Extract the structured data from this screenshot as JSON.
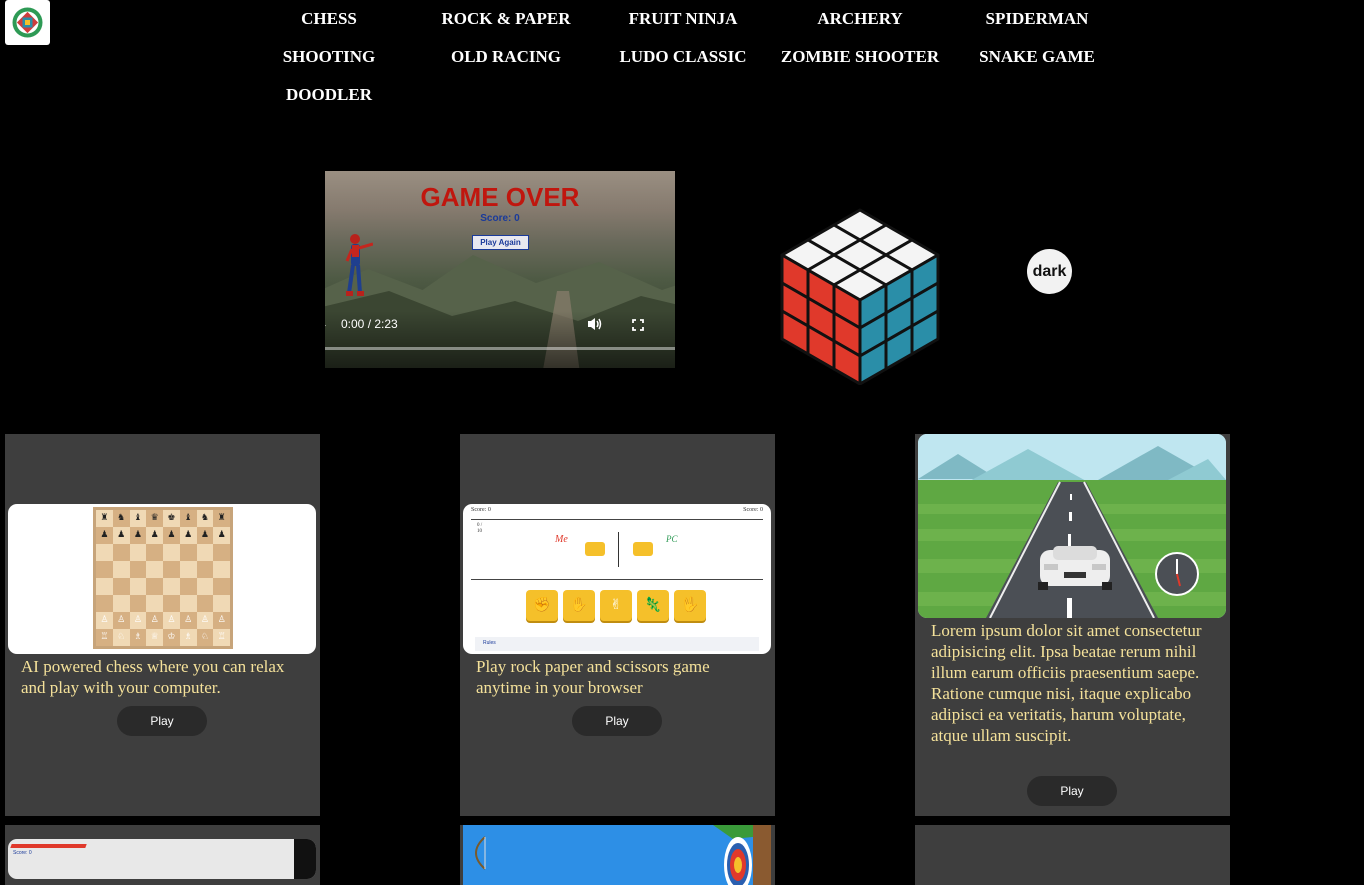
{
  "nav": {
    "items": [
      "CHESS",
      "ROCK & PAPER",
      "FRUIT NINJA",
      "ARCHERY",
      "SPIDERMAN",
      "SHOOTING",
      "OLD RACING",
      "LUDO CLASSIC",
      "ZOMBIE SHOOTER",
      "SNAKE GAME",
      "DOODLER"
    ]
  },
  "video": {
    "game_over": "GAME OVER",
    "score": "Score: 0",
    "play_again": "Play Again",
    "time": "0:00 / 2:23",
    "progress": 0
  },
  "theme_toggle": "dark",
  "cards": [
    {
      "desc": "AI powered chess where you can relax and play with your computer.",
      "play": "Play"
    },
    {
      "desc": "Play rock paper and scissors game anytime in your browser",
      "play": "Play",
      "thumb": {
        "score_left": "Score: 0",
        "score_right": "Score: 0",
        "round": "0 / 10",
        "me": "Me",
        "pc": "PC",
        "rules": "Rules"
      }
    },
    {
      "desc": "Lorem ipsum dolor sit amet consectetur adipisicing elit. Ipsa beatae rerum nihil illum earum officiis praesentium saepe. Ratione cumque nisi, itaque explicabo adipisci ea veritatis, harum voluptate, atque ullam suscipit.",
      "play": "Play"
    }
  ],
  "bottom_thumb": {
    "score": "Score: 0"
  },
  "colors": {
    "background": "#000000",
    "card_bg": "#3e3e3e",
    "desc_text": "#f4e19a",
    "game_over": "#c0160e",
    "score_blue": "#1a3a9a",
    "cube_red": "#e0392b",
    "cube_teal": "#2a8ea8"
  }
}
